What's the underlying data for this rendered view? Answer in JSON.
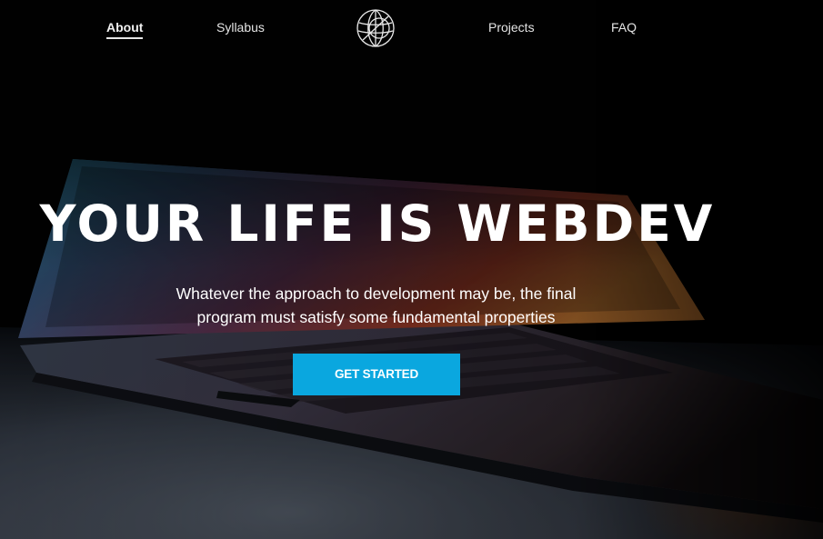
{
  "nav": {
    "items": [
      {
        "label": "About",
        "active": true
      },
      {
        "label": "Syllabus",
        "active": false
      },
      {
        "label": "Projects",
        "active": false
      },
      {
        "label": "FAQ",
        "active": false
      }
    ],
    "logo_icon": "globe-logo-icon"
  },
  "hero": {
    "title": "YOUR LIFE IS WEBDEV",
    "subtitle_line1": "Whatever the approach to development may be, the final",
    "subtitle_line2": "program must satisfy some fundamental properties",
    "cta_label": "GET STARTED"
  },
  "colors": {
    "accent": "#0aa7df",
    "text": "#ffffff",
    "background": "#020202"
  },
  "background_image": "laptop-photo"
}
